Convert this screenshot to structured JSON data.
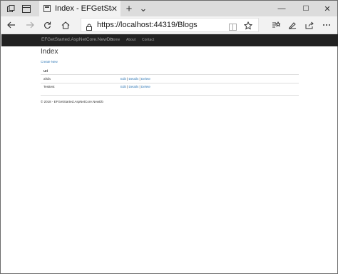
{
  "browser": {
    "tab_title": "Index - EFGetStarted.As",
    "new_tab": "+",
    "tab_list": "⌄",
    "minimize": "—",
    "maximize": "☐",
    "close": "✕",
    "url": "https://localhost:44319/Blogs"
  },
  "site": {
    "brand": "EFGetStarted.AspNetCore.NewDb",
    "nav": [
      "Home",
      "About",
      "Contact"
    ]
  },
  "page": {
    "title": "Index",
    "create_link": "Create New",
    "column_header": "Url",
    "rows": [
      {
        "url": "afsfa",
        "edit": "Edit",
        "details": "Details",
        "delete": "Delete"
      },
      {
        "url": "Testtest",
        "edit": "Edit",
        "details": "Details",
        "delete": "Delete"
      }
    ],
    "separator": " | ",
    "footer": "© 2018 - EFGetStarted.AspNetCore.NewDb"
  }
}
